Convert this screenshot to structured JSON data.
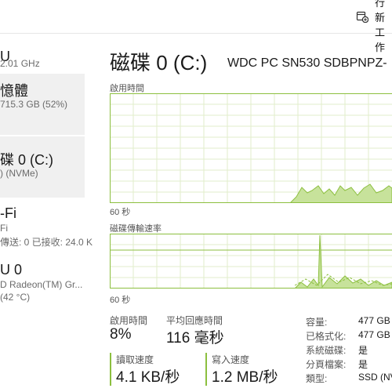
{
  "header": {
    "run_task_label": "執行新工作"
  },
  "sidebar": {
    "items": [
      {
        "title": "U",
        "sub": "2.01 GHz"
      },
      {
        "title": "憶體",
        "sub": "715.3 GB (52%)"
      },
      {
        "title": "碟 0 (C:)",
        "sub": ") (NVMe)"
      },
      {
        "title": "-Fi",
        "sub": "Fi",
        "sub2": "傳送: 0 已接收: 24.0 K"
      },
      {
        "title": "U 0",
        "sub": "D Radeon(TM) Gr...",
        "sub2": "(42 °C)"
      }
    ]
  },
  "main": {
    "title": "磁碟 0 (C:)",
    "model": "WDC PC SN530 SDBPNPZ-",
    "graph1": {
      "label": "啟用時間",
      "time_label": "60 秒"
    },
    "graph2": {
      "label": "磁碟傳輸速率",
      "time_label": "60 秒"
    }
  },
  "stats": {
    "active_time": {
      "label": "啟用時間",
      "value": "8%"
    },
    "avg_response": {
      "label": "平均回應時間",
      "value": "116 毫秒"
    },
    "read_speed": {
      "label": "讀取速度",
      "value": "4.1 KB/秒"
    },
    "write_speed": {
      "label": "寫入速度",
      "value": "1.2 MB/秒"
    }
  },
  "properties": [
    {
      "key": "容量:",
      "value": "477 GB"
    },
    {
      "key": "已格式化:",
      "value": "477 GB"
    },
    {
      "key": "系統磁碟:",
      "value": "是"
    },
    {
      "key": "分頁檔案:",
      "value": "是"
    },
    {
      "key": "類型:",
      "value": "SSD (NV"
    }
  ],
  "colors": {
    "accent": "#8cbf3f",
    "fill": "#c7e29b",
    "grid": "#e2eecb",
    "border": "#8cbf3f"
  }
}
